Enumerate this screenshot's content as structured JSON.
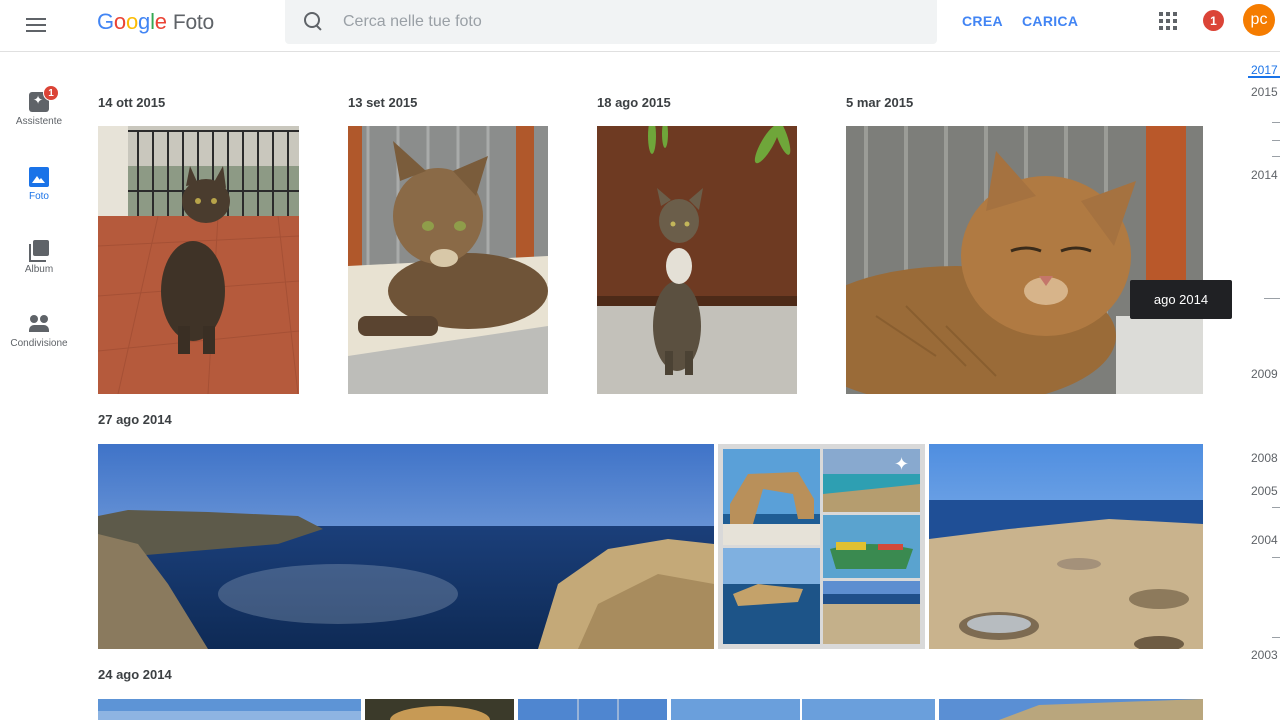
{
  "header": {
    "logo_google": [
      "G",
      "o",
      "o",
      "g",
      "l",
      "e"
    ],
    "logo_product": "Foto",
    "search_placeholder": "Cerca nelle tue foto",
    "create_label": "CREA",
    "upload_label": "CARICA",
    "notification_count": "1",
    "avatar_initials": "pc"
  },
  "sidebar": {
    "items": [
      {
        "label": "Assistente",
        "icon": "assistant-icon",
        "badge": "1",
        "active": false
      },
      {
        "label": "Foto",
        "icon": "photo-icon",
        "active": true
      },
      {
        "label": "Album",
        "icon": "album-icon",
        "active": false
      },
      {
        "label": "Condivisione",
        "icon": "sharing-icon",
        "active": false
      }
    ]
  },
  "groups": [
    {
      "date": "14 ott 2015"
    },
    {
      "date": "13 set 2015"
    },
    {
      "date": "18 ago 2015"
    },
    {
      "date": "5 mar 2015"
    },
    {
      "date": "27 ago 2014"
    },
    {
      "date": "24 ago 2014"
    }
  ],
  "tooltip": "ago 2014",
  "timeline": {
    "years": [
      "2017",
      "2015",
      "2014",
      "2009",
      "2008",
      "2005",
      "2004",
      "2003"
    ],
    "current": "2017"
  },
  "colors": {
    "accent": "#1a73e8",
    "header_button": "#4285f4",
    "notification": "#db4437",
    "avatar": "#f57c00"
  }
}
